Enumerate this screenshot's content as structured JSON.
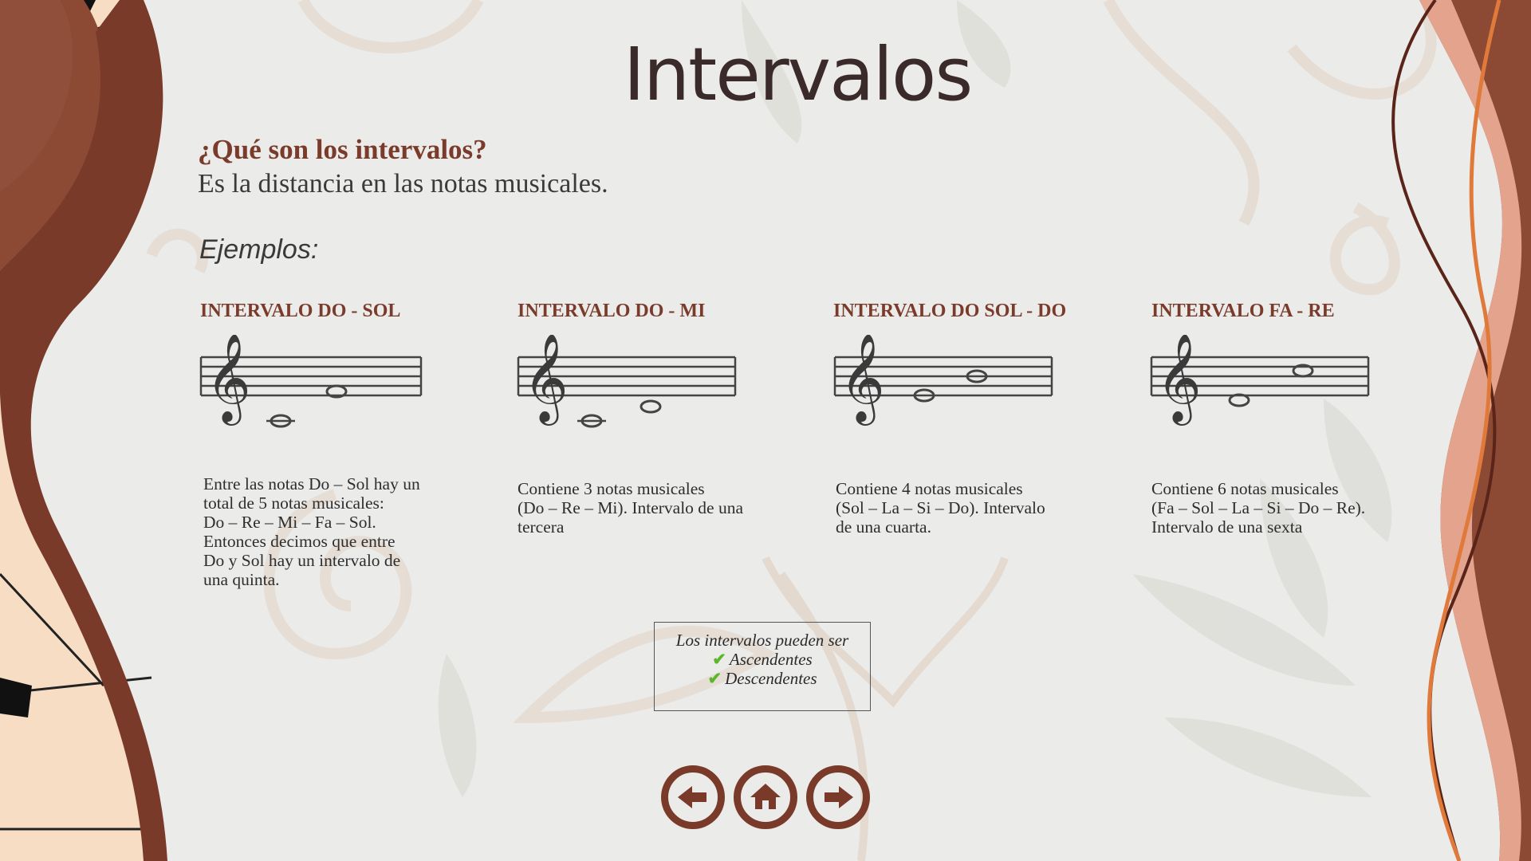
{
  "slide": {
    "title": "Intervalos",
    "question": "¿Qué son los intervalos?",
    "answer": "Es la distancia en las notas musicales.",
    "examples_label": "Ejemplos:"
  },
  "examples": [
    {
      "title": "INTERVALO DO - SOL",
      "lines": [
        "Entre las notas Do – Sol hay un",
        "total de 5 notas musicales:",
        "Do – Re – Mi – Fa – Sol.",
        "Entonces decimos que entre",
        "Do y Sol hay un intervalo de",
        "una quinta."
      ]
    },
    {
      "title": "INTERVALO DO - MI",
      "lines": [
        "Contiene 3 notas musicales",
        "(Do – Re – Mi). Intervalo de una",
        "tercera"
      ]
    },
    {
      "title": "INTERVALO DO  SOL - DO",
      "lines": [
        "Contiene 4 notas musicales",
        "(Sol – La – Si – Do). Intervalo",
        "de una cuarta."
      ]
    },
    {
      "title": "INTERVALO  FA - RE",
      "lines": [
        "Contiene 6 notas musicales",
        "(Fa – Sol – La – Si – Do – Re).",
        "Intervalo de una sexta"
      ]
    }
  ],
  "info_box": {
    "heading": "Los intervalos pueden ser",
    "items": [
      "Ascendentes",
      "Descendentes"
    ],
    "check_icon": "check-icon",
    "check_color": "#5cb82a"
  },
  "nav": {
    "prev_icon": "arrow-left-icon",
    "home_icon": "home-icon",
    "next_icon": "arrow-right-icon"
  },
  "colors": {
    "accent": "#7b3b2b",
    "background": "#ebebea",
    "piano_cream": "#f7ddc4",
    "brown_dark": "#7a3a2a",
    "salmon": "#e3a38d",
    "orange": "#e07a3b"
  }
}
